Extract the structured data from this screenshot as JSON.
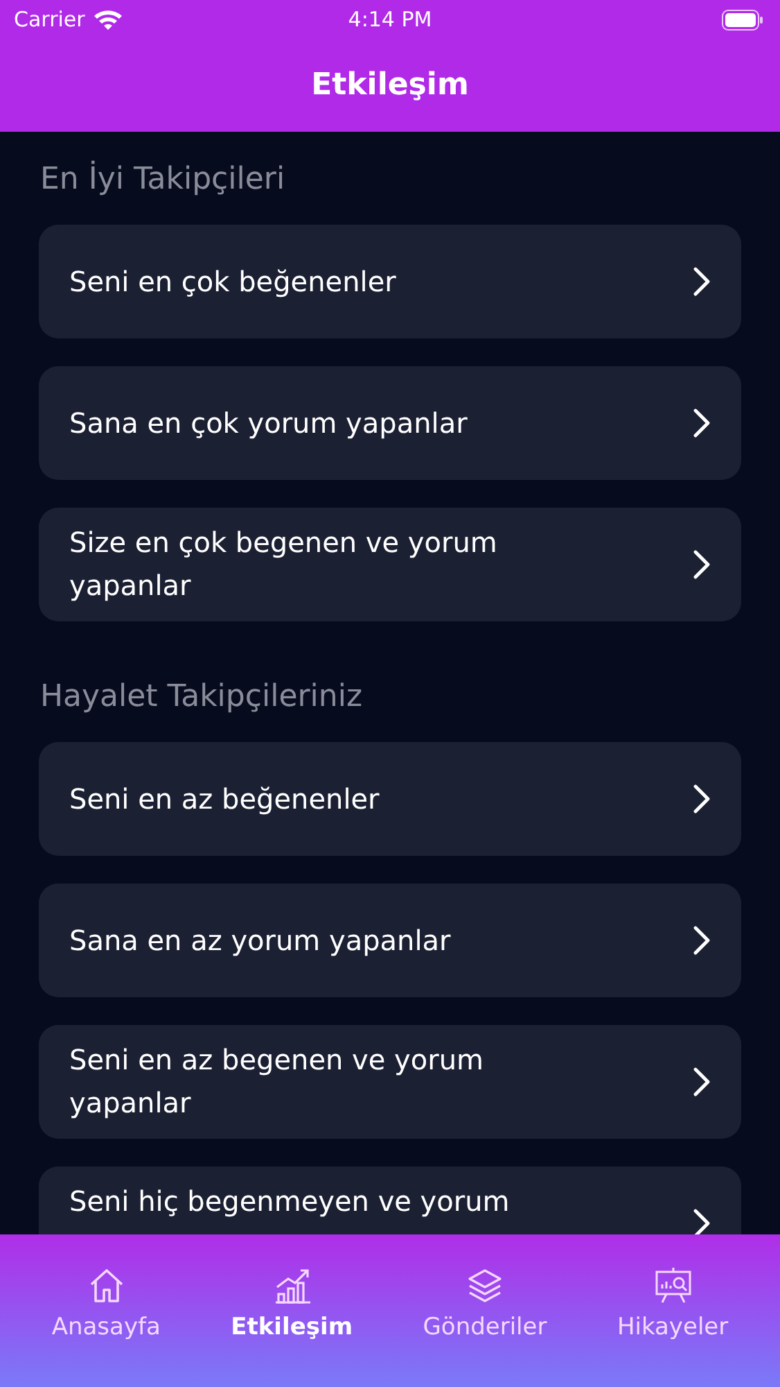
{
  "status_bar": {
    "carrier": "Carrier",
    "time": "4:14 PM"
  },
  "nav": {
    "title": "Etkileşim"
  },
  "sections": [
    {
      "title": "En İyi Takipçileri",
      "items": [
        {
          "label": "Seni en çok beğenenler"
        },
        {
          "label": "Sana en çok yorum yapanlar"
        },
        {
          "label": "Size en çok begenen ve yorum yapanlar"
        }
      ]
    },
    {
      "title": "Hayalet Takipçileriniz",
      "items": [
        {
          "label": "Seni en az beğenenler"
        },
        {
          "label": "Sana en az yorum yapanlar"
        },
        {
          "label": "Seni en az begenen ve yorum yapanlar"
        },
        {
          "label": "Seni hiç begenmeyen ve yorum"
        }
      ]
    }
  ],
  "tabs": [
    {
      "kind": "home",
      "label": "Anasayfa",
      "selected": false
    },
    {
      "kind": "chart",
      "label": "Etkileşim",
      "selected": true
    },
    {
      "kind": "layers",
      "label": "Gönderiler",
      "selected": false
    },
    {
      "kind": "board",
      "label": "Hikayeler",
      "selected": false
    }
  ]
}
